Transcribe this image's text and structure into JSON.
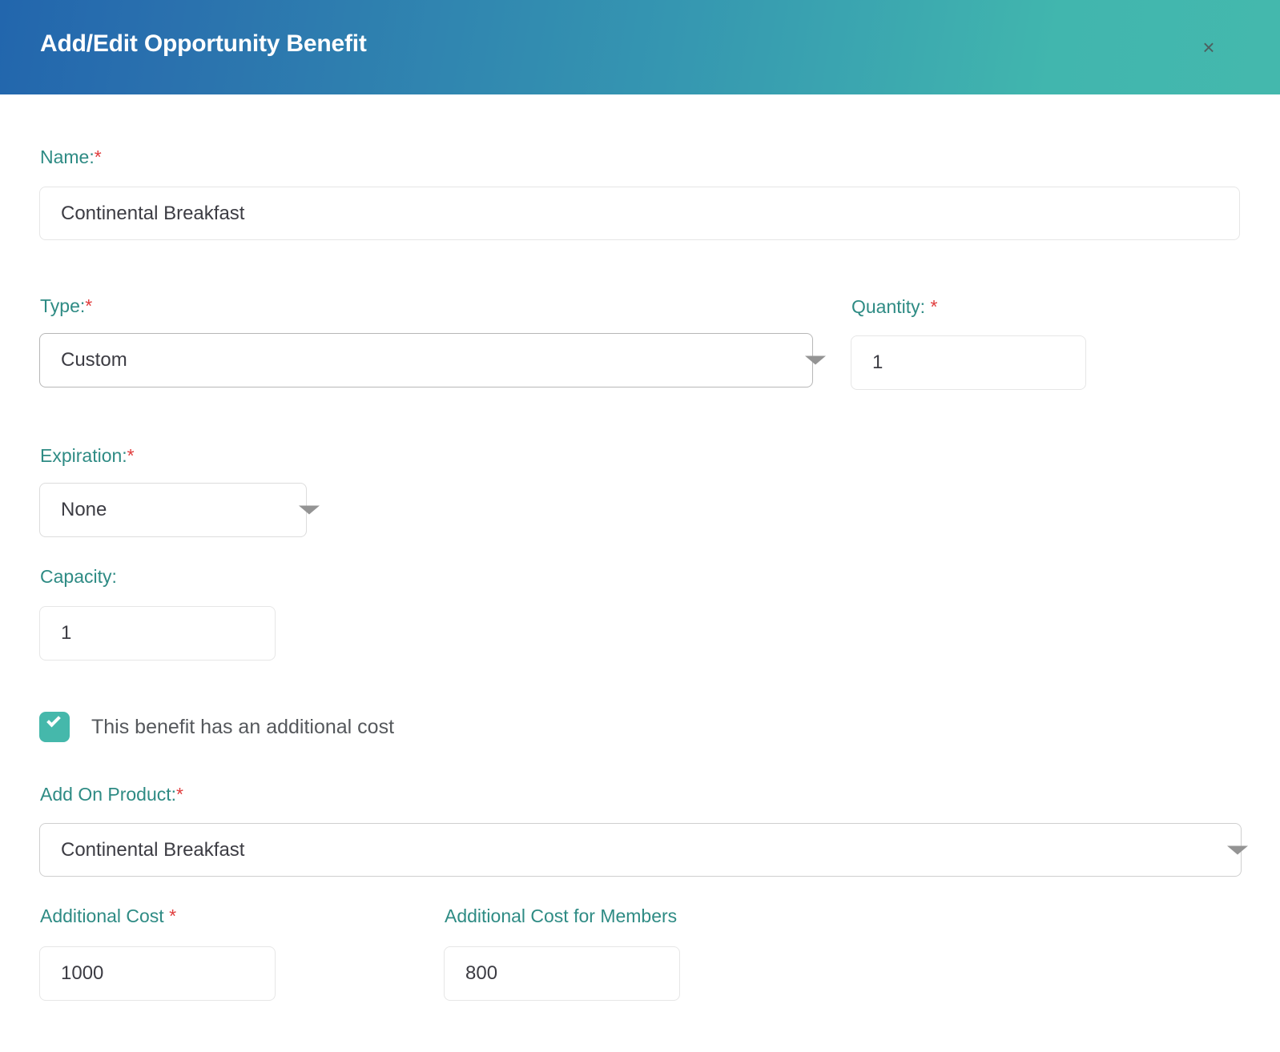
{
  "dialog": {
    "title": "Add/Edit Opportunity Benefit",
    "close_label": "×",
    "close_icon": "close-icon",
    "header_gradient_start": "#2266ad",
    "header_gradient_end": "#44b8ad",
    "label_color": "#2e8b84",
    "required_color": "#e03c3c",
    "accent_color": "#45b8ab"
  },
  "fields": {
    "name": {
      "label": "Name:",
      "required_marker": "*",
      "value": "Continental Breakfast",
      "placeholder": "Name"
    },
    "type": {
      "label": "Type:",
      "required_marker": "*",
      "value": "Custom",
      "options": [
        "Custom"
      ]
    },
    "quantity": {
      "label": "Quantity:",
      "required_marker": "*",
      "value": "1",
      "placeholder": "Quantity"
    },
    "expiration": {
      "label": "Expiration:",
      "required_marker": "*",
      "value": "None",
      "options": [
        "None"
      ]
    },
    "capacity": {
      "label": "Capacity:",
      "required_marker": "",
      "value": "1",
      "placeholder": "Capacity"
    },
    "additional_cost_checkbox": {
      "label": "This benefit has an additional cost",
      "checked": true
    },
    "add_on_product": {
      "label": "Add On Product:",
      "required_marker": "*",
      "value": "Continental Breakfast",
      "options": [
        "Continental Breakfast"
      ]
    },
    "additional_cost": {
      "label": "Additional Cost",
      "required_marker": "*",
      "value": "1000",
      "placeholder": "Additional Cost"
    },
    "additional_cost_members": {
      "label": "Additional Cost for Members",
      "required_marker": "",
      "value": "800",
      "placeholder": "Additional Cost for Members"
    }
  }
}
